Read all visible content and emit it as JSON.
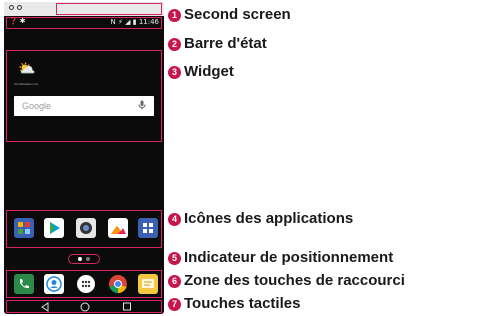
{
  "phone": {
    "status_time": "11:46",
    "status_icons": "N ⚡ ◢ ▮",
    "status_left": "❓ ✱",
    "weather_icon": "⛅",
    "weather_caption": "AccuWeather.com",
    "search_placeholder": "Google",
    "mic_icon": "🎙"
  },
  "callouts": [
    {
      "number": "1",
      "label": "Second screen"
    },
    {
      "number": "2",
      "label": "Barre d'état"
    },
    {
      "number": "3",
      "label": "Widget"
    },
    {
      "number": "4",
      "label": "Icônes des applications"
    },
    {
      "number": "5",
      "label": "Indicateur de positionnement"
    },
    {
      "number": "6",
      "label": "Zone des touches de raccourci"
    },
    {
      "number": "7",
      "label": "Touches tactiles"
    }
  ],
  "colors": {
    "highlight": "#d6246a",
    "badge": "#c8154c"
  },
  "icons": {
    "apps": [
      "apps-folder-icon",
      "play-store-icon",
      "camera-icon",
      "gallery-icon",
      "app-drawer-icon"
    ],
    "shortcuts": [
      "phone-icon",
      "contacts-icon",
      "apps-icon",
      "chrome-icon",
      "messaging-icon"
    ],
    "nav": [
      "back-icon",
      "home-icon",
      "recent-apps-icon"
    ]
  }
}
